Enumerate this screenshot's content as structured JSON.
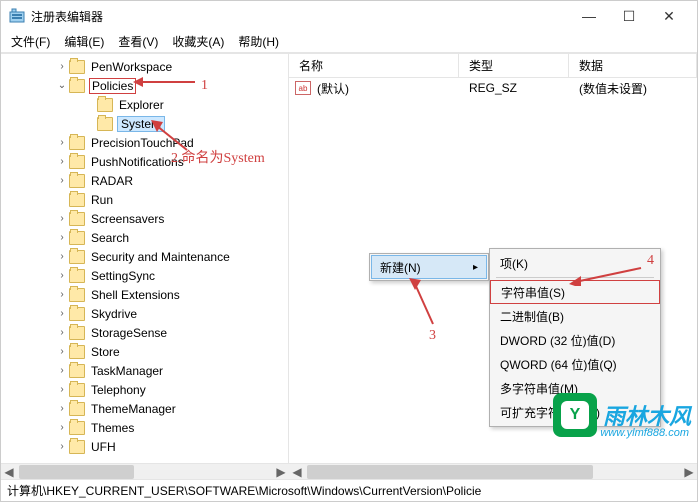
{
  "window": {
    "title": "注册表编辑器"
  },
  "winbuttons": {
    "min": "—",
    "max": "☐",
    "close": "✕"
  },
  "menubar": {
    "file": "文件(F)",
    "edit": "编辑(E)",
    "view": "查看(V)",
    "fav": "收藏夹(A)",
    "help": "帮助(H)"
  },
  "tree": {
    "penworkspace": "PenWorkspace",
    "policies": "Policies",
    "explorer": "Explorer",
    "system": "System",
    "precisiontouchpad": "PrecisionTouchPad",
    "pushnotifications": "PushNotifications",
    "radar": "RADAR",
    "run": "Run",
    "screensavers": "Screensavers",
    "search": "Search",
    "secmaint": "Security and Maintenance",
    "settingsync": "SettingSync",
    "shellext": "Shell Extensions",
    "skydrive": "Skydrive",
    "storagesense": "StorageSense",
    "store": "Store",
    "taskmanager": "TaskManager",
    "telephony": "Telephony",
    "thememanager": "ThemeManager",
    "themes": "Themes",
    "ufh": "UFH"
  },
  "right": {
    "columns": {
      "name": "名称",
      "type": "类型",
      "data": "数据"
    },
    "row_default": {
      "icon": "ab",
      "name": "(默认)",
      "type": "REG_SZ",
      "data": "(数值未设置)"
    }
  },
  "ctx_parent": {
    "new": "新建(N)",
    "arrow": "▸"
  },
  "ctx_sub": {
    "key": "项(K)",
    "string": "字符串值(S)",
    "binary": "二进制值(B)",
    "dword": "DWORD (32 位)值(D)",
    "qword": "QWORD (64 位)值(Q)",
    "multi": "多字符串值(M)",
    "expand": "可扩充字符串值(E)"
  },
  "annotations": {
    "n1": "1",
    "n2": "2.命名为System",
    "n3": "3",
    "n4": "4"
  },
  "statusbar": {
    "path": "计算机\\HKEY_CURRENT_USER\\SOFTWARE\\Microsoft\\Windows\\CurrentVersion\\Policie"
  },
  "watermark": {
    "brand": "雨林木风",
    "url": "www.ylmf888.com",
    "glyph": "Y"
  },
  "scroll": {
    "left": "◀",
    "right": "▶"
  }
}
